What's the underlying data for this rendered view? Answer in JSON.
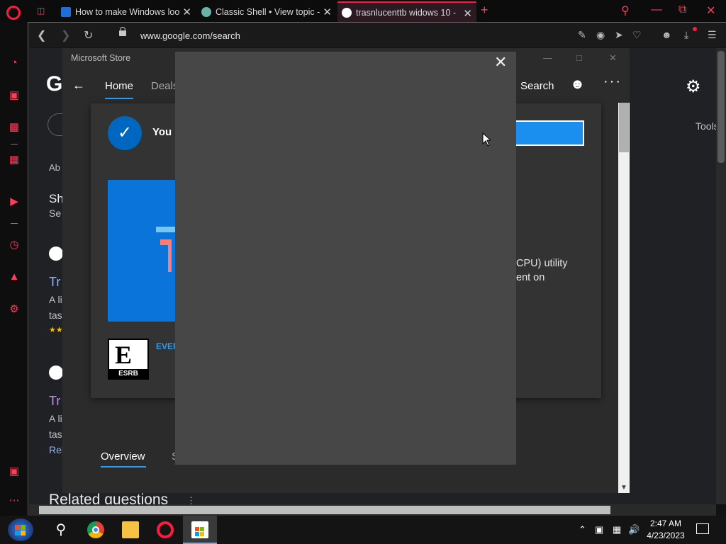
{
  "browser": {
    "tabs": [
      {
        "title": "How to make Windows loo",
        "active": false
      },
      {
        "title": "Classic Shell • View topic -",
        "active": false
      },
      {
        "title": "trasnlucenttb widows 10 -",
        "active": true
      }
    ],
    "url": "www.google.com/search"
  },
  "google": {
    "logo_fragment": "G",
    "tools_label": "Tools",
    "related_questions": "Related questions",
    "fragments": {
      "about": "Ab",
      "sh": "Sh",
      "se": "Se",
      "tr1": "Tr",
      "a_li1": "A li",
      "tas1": "tas",
      "tr2": "Tr",
      "a_li2": "A li",
      "tas2": "tas",
      "rel": "Rel"
    }
  },
  "store": {
    "title": "Microsoft Store",
    "nav": {
      "home": "Home",
      "deals": "Deals",
      "search": "Search"
    },
    "notice": "You c",
    "description_line1": "CPU) utility",
    "description_line2": "ent on",
    "rating_text": "EVER",
    "esrb_label": "ESRB",
    "esrb_letter": "E",
    "overview_tab": "Overview",
    "second_tab": "S"
  },
  "taskbar": {
    "time": "2:47 AM",
    "date": "4/23/2023"
  },
  "colors": {
    "opera_red": "#ff1b3d",
    "store_blue": "#1a8fef",
    "dialog_bg": "#474747"
  }
}
